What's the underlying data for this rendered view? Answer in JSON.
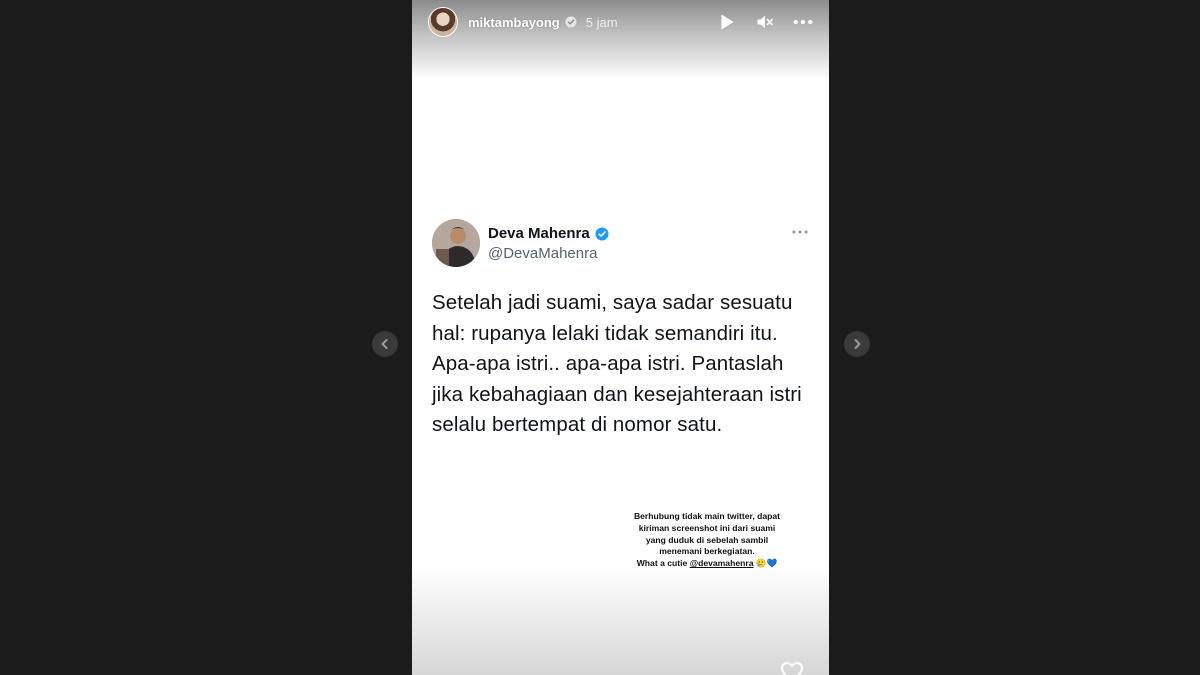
{
  "story": {
    "username": "miktambayong",
    "time": "5 jam",
    "controls": {
      "play_icon": "play-icon",
      "mute_icon": "mute-icon",
      "more_icon": "more-icon"
    }
  },
  "tweet": {
    "display_name": "Deva Mahenra",
    "handle": "@DevaMahenra",
    "text": "Setelah jadi suami, saya sadar sesuatu hal: rupanya lelaki tidak semandiri itu. Apa-apa istri.. apa-apa istri. Pantaslah jika kebahagiaan dan kesejahteraan istri selalu bertempat di nomor satu.",
    "verified_color": "#1d9bf0"
  },
  "caption": {
    "line1": "Berhubung tidak main twitter, dapat",
    "line2": "kiriman screenshot ini dari suami",
    "line3": "yang duduk di sebelah sambil",
    "line4": "menemani berkegiatan.",
    "line5_prefix": "What a cutie ",
    "mention": "@devamahenra",
    "emojis": "🥲💙"
  },
  "icons": {
    "prev": "chevron-left-icon",
    "next": "chevron-right-icon",
    "like": "heart-icon"
  }
}
